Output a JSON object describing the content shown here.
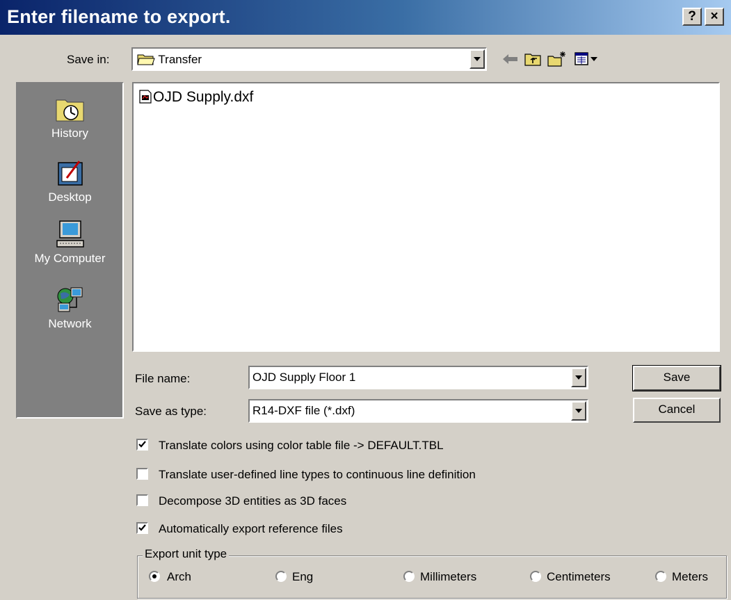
{
  "window": {
    "title": "Enter filename to export.",
    "help_label": "?",
    "close_label": "×"
  },
  "save_in": {
    "label": "Save in:",
    "value": "Transfer"
  },
  "places": [
    {
      "label": "History",
      "icon": "history-icon"
    },
    {
      "label": "Desktop",
      "icon": "desktop-icon"
    },
    {
      "label": "My Computer",
      "icon": "my-computer-icon"
    },
    {
      "label": "Network",
      "icon": "network-icon"
    }
  ],
  "files": [
    {
      "name": "OJD Supply.dxf",
      "icon": "dxf-file-icon"
    }
  ],
  "file_name": {
    "label": "File name:",
    "value": "OJD Supply Floor 1"
  },
  "save_as_type": {
    "label": "Save as type:",
    "value": "R14-DXF file (*.dxf)"
  },
  "buttons": {
    "save": "Save",
    "cancel": "Cancel"
  },
  "options": [
    {
      "label": "Translate colors using color table file  -> DEFAULT.TBL",
      "checked": true
    },
    {
      "label": "Translate user-defined line types to continuous line definition",
      "checked": false
    },
    {
      "label": "Decompose 3D entities as 3D faces",
      "checked": false
    },
    {
      "label": "Automatically export reference files",
      "checked": true
    }
  ],
  "export_unit": {
    "legend": "Export unit type",
    "options": [
      "Arch",
      "Eng",
      "Millimeters",
      "Centimeters",
      "Meters"
    ],
    "selected": "Arch"
  }
}
